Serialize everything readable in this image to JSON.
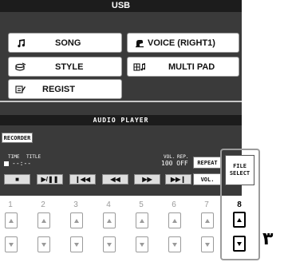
{
  "title": "USB",
  "menu": {
    "song": "SONG",
    "voice": "VOICE (RIGHT1)",
    "style": "STYLE",
    "multipad": "MULTI PAD",
    "regist": "REGIST"
  },
  "audio_player": {
    "header": "AUDIO PLAYER",
    "recorder": "RECORDER",
    "time_label": "TIME",
    "title_label": "TITLE",
    "vol_label": "VOL.",
    "rep_label": "REP.",
    "time_value": "--:--",
    "vol_rep_value": "100 OFF",
    "repeat": "REPEAT",
    "vol": "VOL.",
    "file_select": "FILE SELECT"
  },
  "transport": [
    {
      "name": "stop",
      "icon": "■"
    },
    {
      "name": "play-pause",
      "icon": "▶/❚❚"
    },
    {
      "name": "prev",
      "icon": "❙◀◀"
    },
    {
      "name": "rewind",
      "icon": "◀◀"
    },
    {
      "name": "fast-forward",
      "icon": "▶▶"
    },
    {
      "name": "next",
      "icon": "▶▶❙"
    }
  ],
  "numbers": [
    "1",
    "2",
    "3",
    "4",
    "5",
    "6",
    "7",
    "8"
  ],
  "active_number": "8",
  "callout": "٣"
}
